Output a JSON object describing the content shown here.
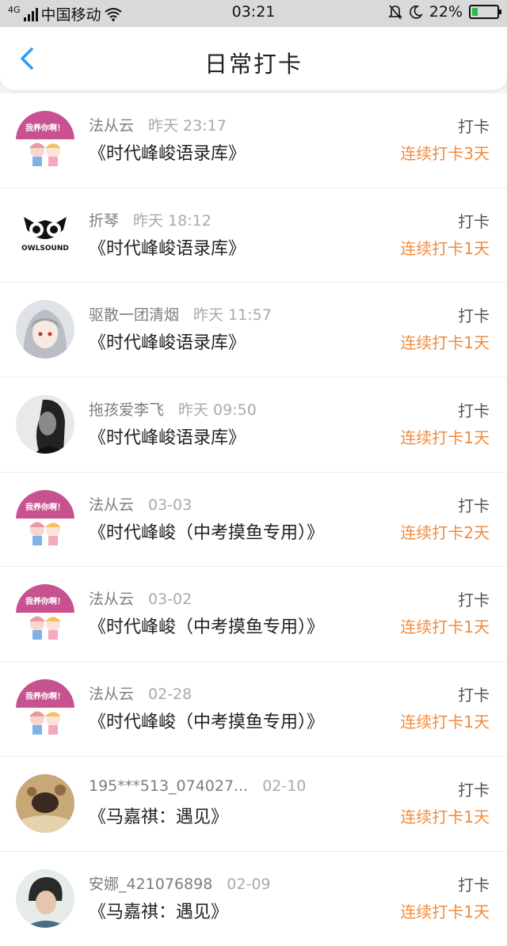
{
  "status": {
    "carrier": "中国移动",
    "network": "4G",
    "time": "03:21",
    "battery_pct": "22%",
    "battery_level": 0.22,
    "battery_color": "#2db84a",
    "icons": [
      "signal-icon",
      "wifi-icon",
      "mute-bell-icon",
      "moon-icon",
      "battery-icon"
    ]
  },
  "header": {
    "title": "日常打卡",
    "back_icon": "chevron-left-icon",
    "accent": "#2f9cf0"
  },
  "colors": {
    "streak": "#f08b3e"
  },
  "list": [
    {
      "user": "法从云",
      "time": "昨天 23:17",
      "book": "《时代峰峻语录库》",
      "action": "打卡",
      "streak": "连续打卡3天",
      "avatar": "avatar-woyangnia"
    },
    {
      "user": "折琴",
      "time": "昨天 18:12",
      "book": "《时代峰峻语录库》",
      "action": "打卡",
      "streak": "连续打卡1天",
      "avatar": "avatar-owlsound",
      "avatar_text": "OWLSOUND"
    },
    {
      "user": "驱散一团清烟",
      "time": "昨天 11:57",
      "book": "《时代峰峻语录库》",
      "action": "打卡",
      "streak": "连续打卡1天",
      "avatar": "avatar-anime-girl"
    },
    {
      "user": "拖孩爱李飞",
      "time": "昨天 09:50",
      "book": "《时代峰峻语录库》",
      "action": "打卡",
      "streak": "连续打卡1天",
      "avatar": "avatar-bw-portrait"
    },
    {
      "user": "法从云",
      "time": "03-03",
      "book": "《时代峰峻（中考摸鱼专用）》",
      "action": "打卡",
      "streak": "连续打卡2天",
      "avatar": "avatar-woyangnia"
    },
    {
      "user": "法从云",
      "time": "03-02",
      "book": "《时代峰峻（中考摸鱼专用）》",
      "action": "打卡",
      "streak": "连续打卡1天",
      "avatar": "avatar-woyangnia"
    },
    {
      "user": "法从云",
      "time": "02-28",
      "book": "《时代峰峻（中考摸鱼专用）》",
      "action": "打卡",
      "streak": "连续打卡1天",
      "avatar": "avatar-woyangnia"
    },
    {
      "user": "195***513_074027...",
      "time": "02-10",
      "book": "《马嘉祺：遇见》",
      "action": "打卡",
      "streak": "连续打卡1天",
      "avatar": "avatar-photo"
    },
    {
      "user": "安娜_421076898",
      "time": "02-09",
      "book": "《马嘉祺：遇见》",
      "action": "打卡",
      "streak": "连续打卡1天",
      "avatar": "avatar-person-photo"
    }
  ],
  "woyangnia_badge": "我养你啊！"
}
